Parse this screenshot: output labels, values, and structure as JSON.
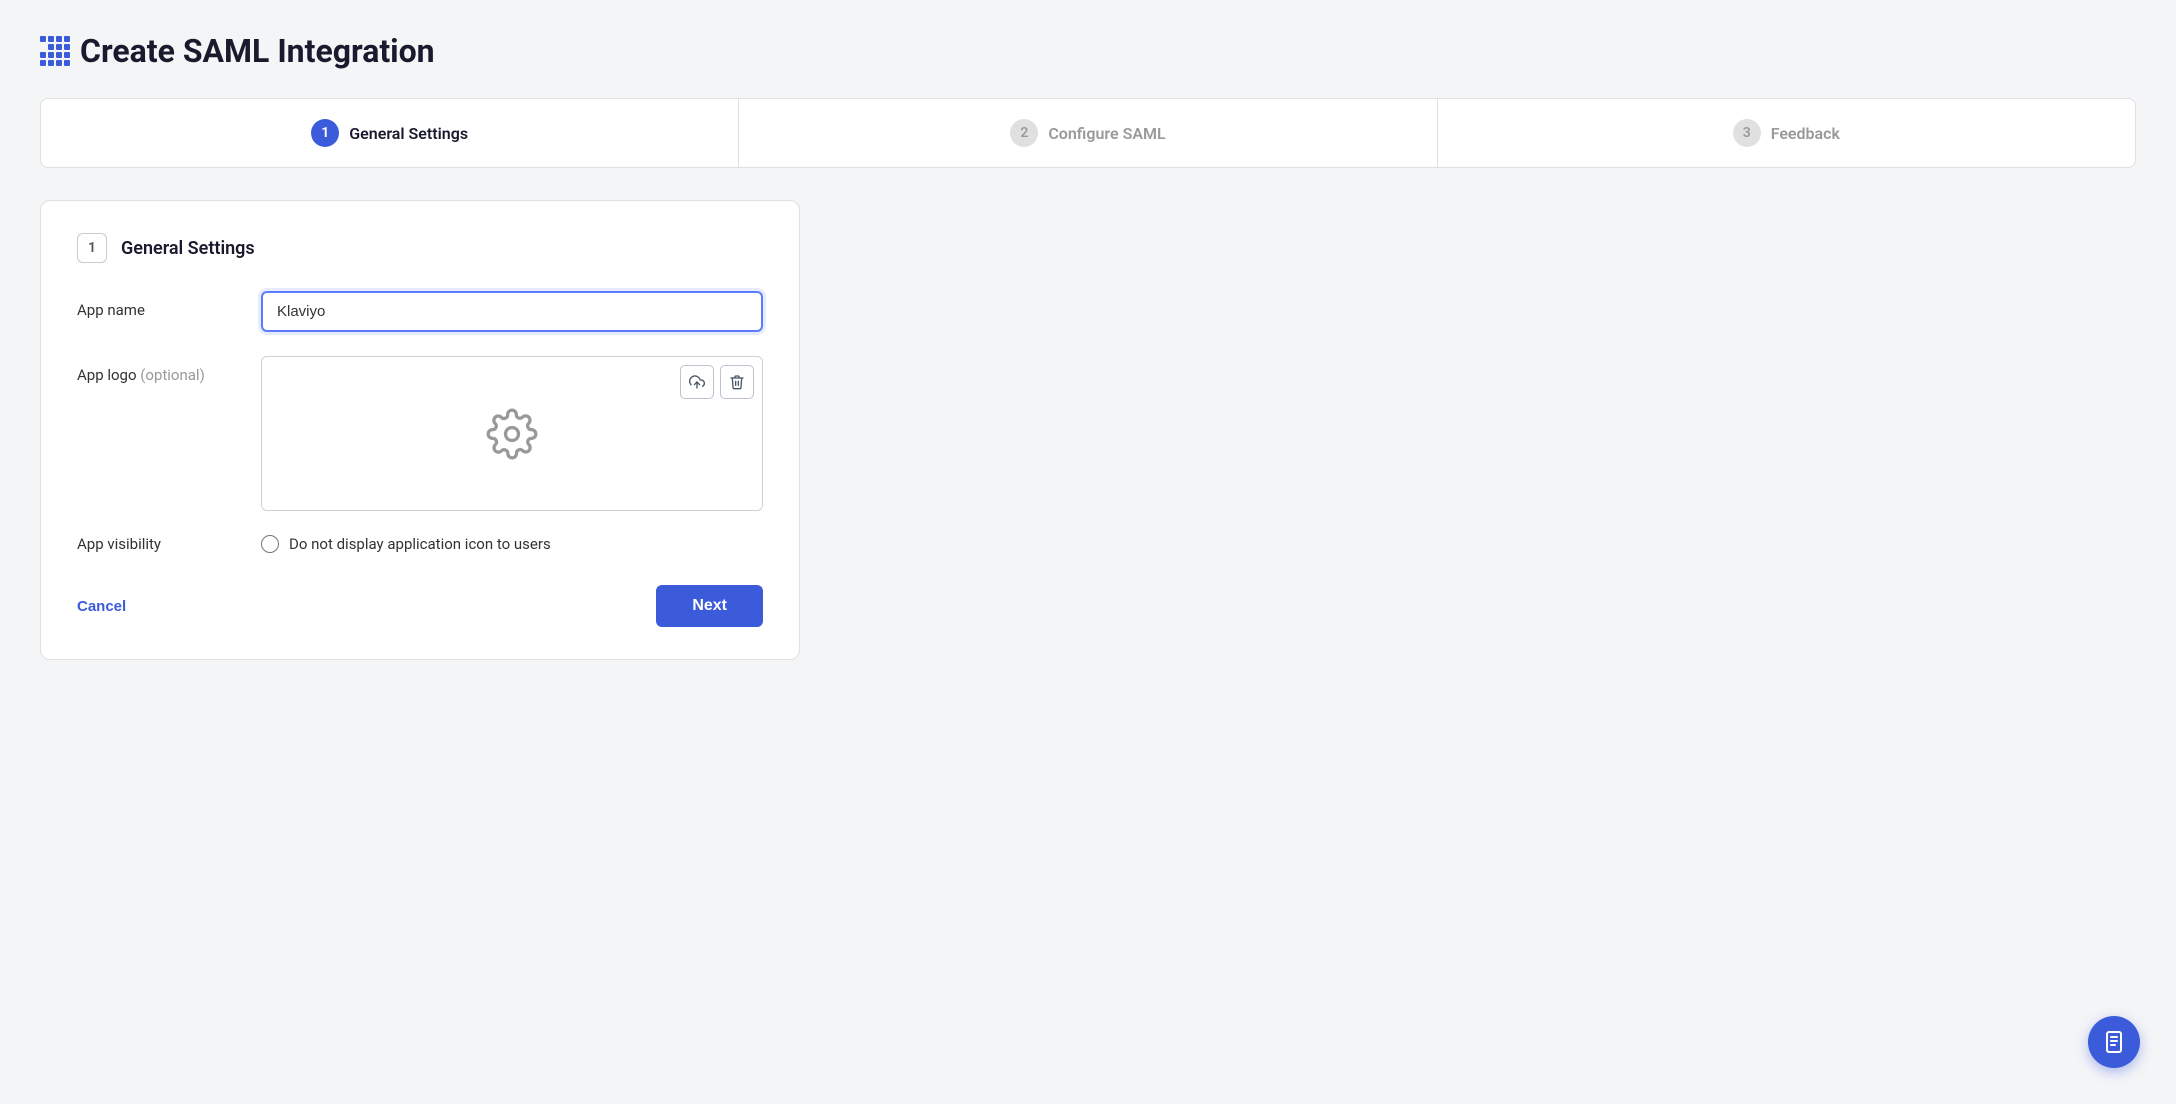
{
  "page": {
    "title": "Create SAML Integration",
    "grid_icon_cells": 16
  },
  "stepper": {
    "steps": [
      {
        "number": "1",
        "label": "General Settings",
        "state": "active"
      },
      {
        "number": "2",
        "label": "Configure SAML",
        "state": "inactive"
      },
      {
        "number": "3",
        "label": "Feedback",
        "state": "inactive"
      }
    ]
  },
  "form": {
    "section_number": "1",
    "section_title": "General Settings",
    "app_name_label": "App name",
    "app_name_value": "Klaviyo",
    "app_name_placeholder": "",
    "app_logo_label": "App logo",
    "app_logo_optional": "(optional)",
    "app_visibility_label": "App visibility",
    "app_visibility_option": "Do not display application icon to users",
    "cancel_label": "Cancel",
    "next_label": "Next"
  },
  "floating": {
    "icon": "📋"
  }
}
